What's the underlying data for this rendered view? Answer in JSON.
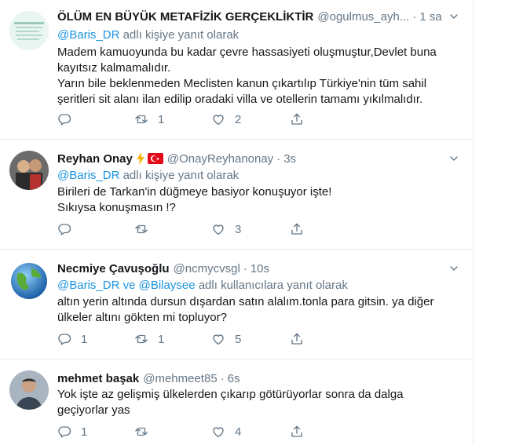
{
  "tweets": [
    {
      "name": "ÖLÜM EN BÜYÜK METAFİZİK GERÇEKLİKTİR",
      "handle": "@ogulmus_ayh...",
      "dot": "·",
      "time": "1 sa",
      "reply_mention_1": "@Baris_DR",
      "reply_suffix": " adlı kişiye yanıt olarak",
      "body": "Madem kamuoyunda bu kadar çevre hassasiyeti oluşmuştur,Devlet buna kayıtsız kalmamalıdır.\nYarın bile beklenmeden Meclisten kanun çıkartılıp Türkiye'nin tüm sahil şeritleri sit alanı ilan edilip oradaki villa ve otellerin tamamı yıkılmalıdır.",
      "replies": "",
      "retweets": "1",
      "likes": "2"
    },
    {
      "name": "Reyhan Onay",
      "badge_icons": [
        "lightning-icon",
        "turkey-flag-icon"
      ],
      "handle": "@OnayReyhanonay",
      "dot": "·",
      "time": "3s",
      "reply_mention_1": "@Baris_DR",
      "reply_suffix": " adlı kişiye yanıt olarak",
      "body": "Birileri de Tarkan'in düğmeye basiyor konuşuyor işte!\nSıkıysa konuşmasın !?",
      "replies": "",
      "retweets": "",
      "likes": "3"
    },
    {
      "name": "Necmiye Çavuşoğlu",
      "handle": "@ncmycvsgl",
      "dot": "·",
      "time": "10s",
      "reply_mention_1": "@Baris_DR",
      "reply_joiner": " ve ",
      "reply_mention_2": "@Bilaysee",
      "reply_suffix": " adlı kullanıcılara yanıt olarak",
      "body": "altın yerin altında dursun dışardan satın alalım.tonla para gitsin. ya diğer ülkeler altını gökten mi topluyor?",
      "replies": "1",
      "retweets": "1",
      "likes": "5"
    },
    {
      "name": "mehmet başak",
      "handle": "@mehmeet85",
      "dot": "·",
      "time": "6s",
      "body": "Yok işte az gelişmiş ülkelerden çıkarıp götürüyorlar sonra da dalga geçiyorlar yas",
      "replies": "1",
      "retweets": "",
      "likes": "4"
    }
  ],
  "colors": {
    "link": "#1b95e0",
    "muted": "#657786",
    "text": "#14171a",
    "divider": "#e6ecf0"
  }
}
